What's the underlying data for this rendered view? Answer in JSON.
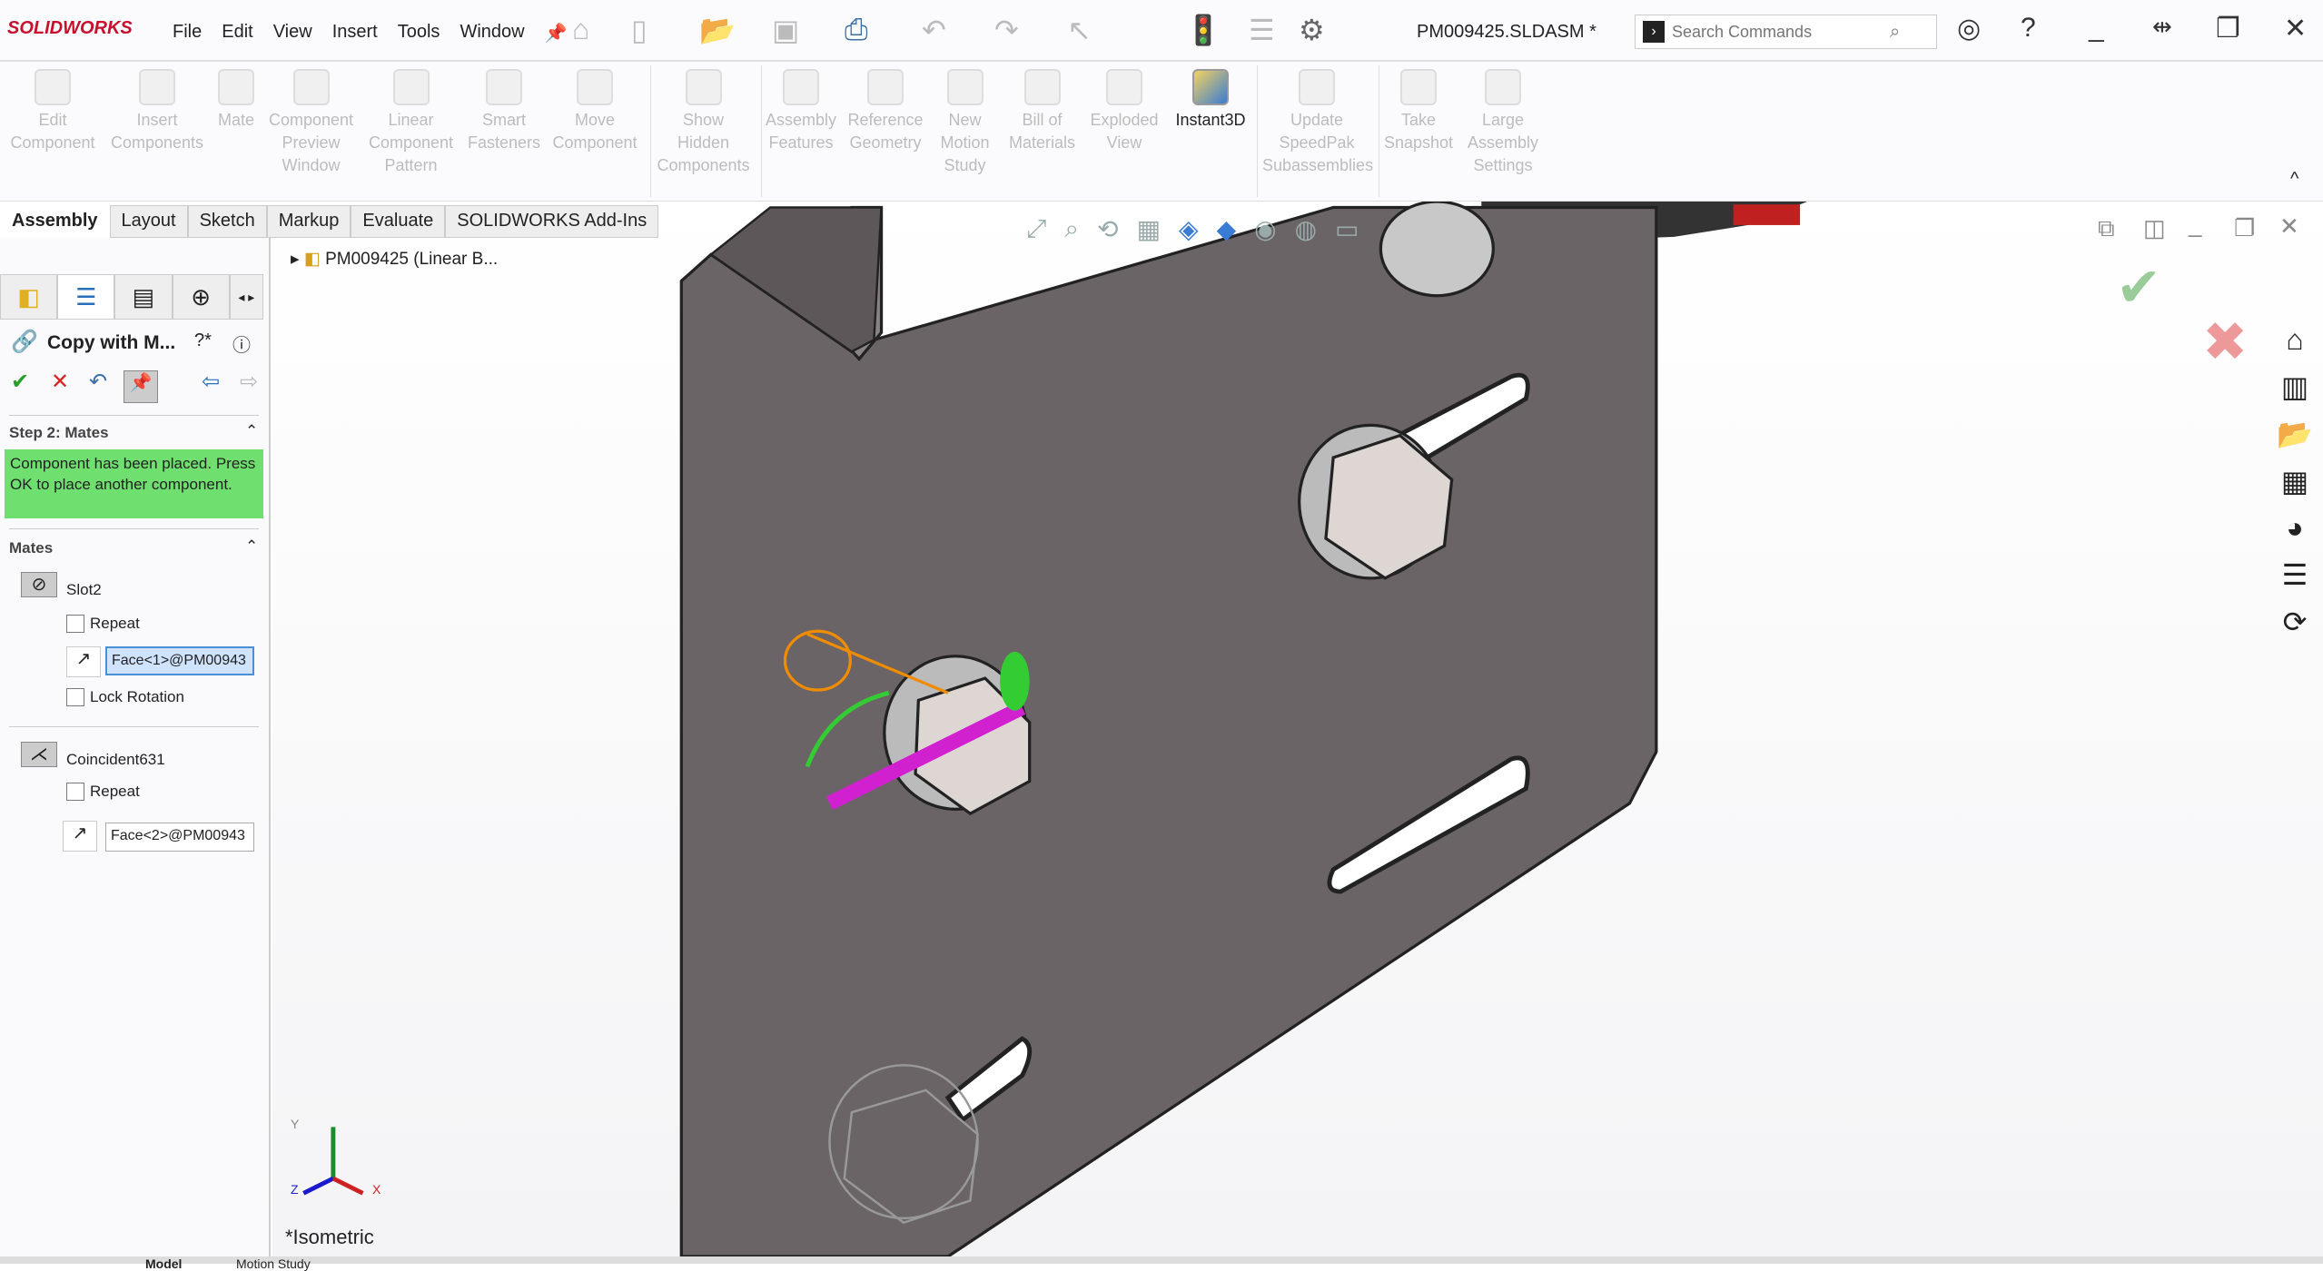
{
  "app": {
    "logo": "SOLIDWORKS",
    "document_title": "PM009425.SLDASM *",
    "accent": "#c8102e"
  },
  "menu": [
    "File",
    "Edit",
    "View",
    "Insert",
    "Tools",
    "Window"
  ],
  "search": {
    "placeholder": "Search Commands"
  },
  "ribbon": [
    {
      "label": "Edit Component",
      "enabled": false
    },
    {
      "label": "Insert Components",
      "enabled": false
    },
    {
      "label": "Mate",
      "enabled": false
    },
    {
      "label": "Component Preview Window",
      "enabled": false
    },
    {
      "label": "Linear Component Pattern",
      "enabled": false
    },
    {
      "label": "Smart Fasteners",
      "enabled": false
    },
    {
      "label": "Move Component",
      "enabled": false
    },
    {
      "label": "Show Hidden Components",
      "enabled": false
    },
    {
      "label": "Assembly Features",
      "enabled": false
    },
    {
      "label": "Reference Geometry",
      "enabled": false
    },
    {
      "label": "New Motion Study",
      "enabled": false
    },
    {
      "label": "Bill of Materials",
      "enabled": false
    },
    {
      "label": "Exploded View",
      "enabled": false
    },
    {
      "label": "Instant3D",
      "enabled": true
    },
    {
      "label": "Update SpeedPak Subassemblies",
      "enabled": false
    },
    {
      "label": "Take Snapshot",
      "enabled": false
    },
    {
      "label": "Large Assembly Settings",
      "enabled": false
    }
  ],
  "tabs": [
    "Assembly",
    "Layout",
    "Sketch",
    "Markup",
    "Evaluate",
    "SOLIDWORKS Add-Ins"
  ],
  "property_manager": {
    "title": "Copy with M...",
    "step_heading": "Step 2: Mates",
    "message": "Component has been placed. Press OK to place another component.",
    "message_color": "#6fe06f",
    "mates_heading": "Mates",
    "mates": [
      {
        "name": "Slot2",
        "repeat_label": "Repeat",
        "repeat": false,
        "selection": "Face<1>@PM00943",
        "lock_rotation_label": "Lock Rotation",
        "lock_rotation": false
      },
      {
        "name": "Coincident631",
        "repeat_label": "Repeat",
        "repeat": false,
        "selection": "Face<2>@PM00943"
      }
    ]
  },
  "tree": {
    "root": "PM009425 (Linear B..."
  },
  "viewport": {
    "view_name": "*Isometric",
    "axes": {
      "x": "X",
      "y": "Y",
      "z": "Z"
    }
  },
  "bottom_tabs": [
    "Model",
    "Motion Study"
  ]
}
